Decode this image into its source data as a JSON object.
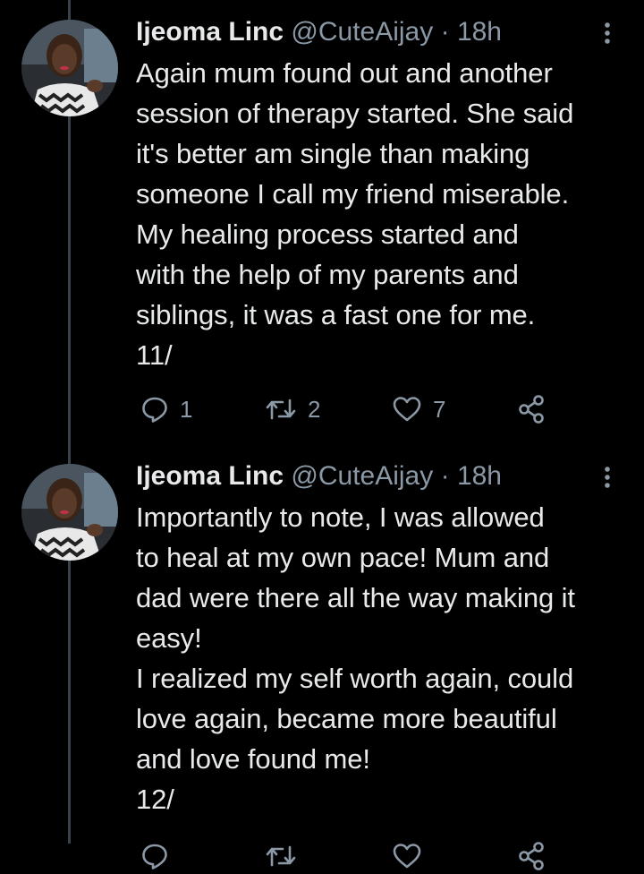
{
  "colors": {
    "background": "#000000",
    "text": "#e7e9ea",
    "muted": "#8b98a5",
    "thread_line": "#3b4148"
  },
  "tweets": [
    {
      "name": "Ijeoma Linc",
      "handle": "@CuteAijay",
      "separator": "·",
      "time": "18h",
      "more_icon": "vertical-dots-icon",
      "lines": [
        "Again mum found out and another",
        "session of therapy started. She said",
        "it's better am single than making",
        "someone I call my friend miserable.",
        "My healing process started and",
        "with the help of my parents and",
        "siblings, it was a fast one for me.",
        "11/"
      ],
      "replies": "1",
      "retweets": "2",
      "likes": "7"
    },
    {
      "name": "Ijeoma Linc",
      "handle": "@CuteAijay",
      "separator": "·",
      "time": "18h",
      "more_icon": "vertical-dots-icon",
      "lines": [
        "Importantly to note, I was allowed",
        "to heal at my own pace! Mum and",
        "dad were there all the way making it",
        "easy!",
        "I realized my self worth again, could",
        "love again, became more beautiful",
        "and love found me!",
        "12/"
      ]
    }
  ]
}
